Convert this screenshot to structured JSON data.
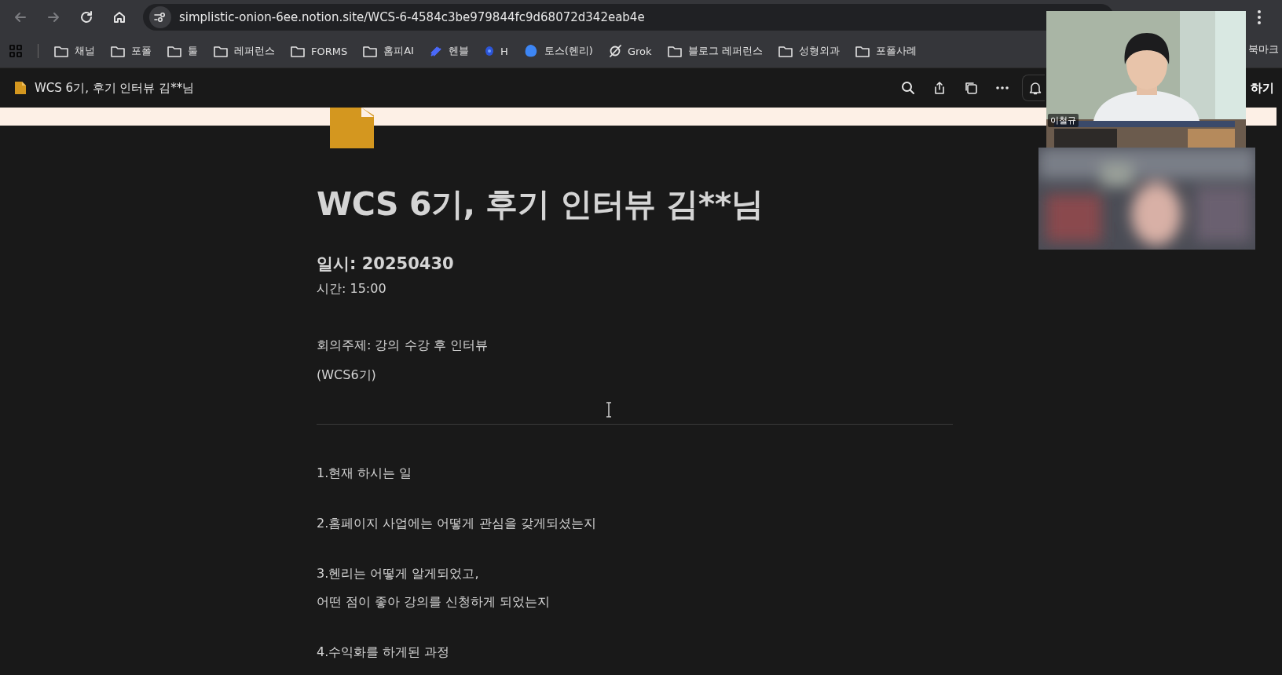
{
  "browser": {
    "url": "simplistic-onion-6ee.notion.site/WCS-6-4584c3be979844fc9d68072d342eab4e",
    "bookmarks": [
      {
        "label": "채널",
        "kind": "folder"
      },
      {
        "label": "포폴",
        "kind": "folder"
      },
      {
        "label": "툴",
        "kind": "folder"
      },
      {
        "label": "레퍼런스",
        "kind": "folder"
      },
      {
        "label": "FORMS",
        "kind": "folder"
      },
      {
        "label": "홈피AI",
        "kind": "folder"
      },
      {
        "label": "헨블",
        "kind": "pen"
      },
      {
        "label": "H",
        "kind": "sphere"
      },
      {
        "label": "토스(헨리)",
        "kind": "blob"
      },
      {
        "label": "Grok",
        "kind": "grok"
      },
      {
        "label": "블로그 레퍼런스",
        "kind": "folder"
      },
      {
        "label": "성형외과",
        "kind": "folder"
      },
      {
        "label": "포폴사례",
        "kind": "folder"
      }
    ],
    "overflow_label": "북마크"
  },
  "notion_bar": {
    "page_title": "WCS 6기, 후기 인터뷰 김**님",
    "share_label": "하기"
  },
  "page": {
    "title": "WCS 6기, 후기 인터뷰 김**님",
    "date": "일시: 20250430",
    "time": "시간: 15:00",
    "topic": "회의주제: 강의 수강 후 인터뷰",
    "cohort": "(WCS6기)",
    "questions": [
      {
        "lines": [
          "1.현재 하시는 일"
        ]
      },
      {
        "lines": [
          "2.홈페이지 사업에는 어떻게 관심을 갖게되셨는지"
        ]
      },
      {
        "lines": [
          "3.헨리는 어떻게 알게되었고,",
          "어떤 점이 좋아 강의를 신청하게 되었는지"
        ]
      },
      {
        "lines": [
          "4.수익화를 하게된 과정"
        ]
      }
    ]
  },
  "video_call": {
    "participant_name": "이철규"
  }
}
